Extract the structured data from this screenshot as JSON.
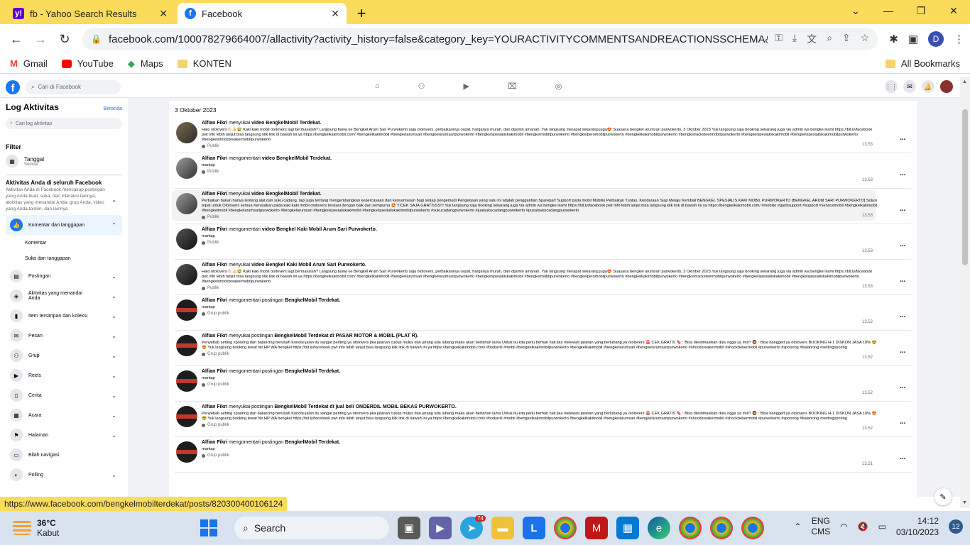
{
  "browser": {
    "tabs": [
      {
        "title": "fb - Yahoo Search Results",
        "icon": "yahoo-icon"
      },
      {
        "title": "Facebook",
        "icon": "facebook-icon"
      }
    ],
    "url": "facebook.com/100078279664007/allactivity?activity_history=false&category_key=YOURACTIVITYCOMMENTSANDREACTIONSSCHEMA&mana...",
    "profile_initial": "D",
    "bookmarks": [
      {
        "label": "Gmail",
        "color": "#ea4335"
      },
      {
        "label": "YouTube",
        "color": "#ff0000"
      },
      {
        "label": "Maps",
        "color": "#34a853"
      },
      {
        "label": "KONTEN",
        "color": "#f6d36b"
      }
    ],
    "all_bookmarks": "All Bookmarks",
    "status_url": "https://www.facebook.com/bengkelmobilterdekat/posts/820300400106124"
  },
  "fb": {
    "search_placeholder": "Cari di Facebook"
  },
  "sidebar": {
    "title": "Log Aktivitas",
    "home_link": "Beranda",
    "search_placeholder": "Cari log aktivitas",
    "filter_label": "Filter",
    "date_label": "Tanggal",
    "date_value": "Semua",
    "activity_title": "Aktivitas Anda di seluruh Facebook",
    "activity_desc": "Aktivitas Anda di Facebook mencakup postingan yang Anda buat, suka, dan interaksi lainnya, aktivitas yang menandai Anda, grup Anda, video yang Anda tonton, dan lainnya",
    "active_item": "Komentar dan tanggapan",
    "sub_items": [
      "Komentar",
      "Suka dan tanggapan"
    ],
    "items": [
      "Postingan",
      "Aktivitas yang menandai Anda",
      "Item tersimpan dan koleksi",
      "Pesan",
      "Grup",
      "Reels",
      "Cerita",
      "Acara",
      "Halaman",
      "Bilah navigasi",
      "Polling"
    ]
  },
  "log": {
    "date_header": "3 Oktober 2023",
    "entries": [
      {
        "actor": "Alfian Fikri",
        "verb": "menyukai",
        "object": "video BengkelMobil Terdekat.",
        "desc": "Halo otolovers👋🏻👍🏻😅 Kaki kaki mobil otolovers lagi bermasalah? Langsung bawa ke Bengkel Arum Sari Purwokerto saja otolovers, perbaikannya cepat, harganya murah, dan dijamin amanah. Yuk langsung merapat sekarang juga😍 Suasana bengkel arumsari purwokerto, 3 Oktober 2023 Yuk langsung saja booking sekarang juga via admin wa bengkel kami https://bit.ly/facebook pwt info lebih lanjut bisa langsung klik link di bawah ini ya https://bengkelkakimobil.com/ #bengkelkakimobil #bengkelarumsari #bengkelarumsaripurwokerto #bengkelspesialiskakimobil #bengkelmobilpurwokerto #bengkelperomobilpurwokerto #bengkelkakimobilpurwokerto #bengkelracksteermobilpurwokerto #bengkelspesialiskakimobil #bengkelspesialiskakimobilpurwokerto #bengkelshockbreakermobilpurwokerto",
        "audience": "Publik",
        "time": "13.53",
        "avatar": "gold"
      },
      {
        "actor": "Alfian Fikri",
        "verb": "mengomentari",
        "object": "video BengkelMobil Terdekat.",
        "desc": "mantap",
        "audience": "Publik",
        "time": "13.53",
        "avatar": "grey"
      },
      {
        "actor": "Alfian Fikri",
        "verb": "menyukai",
        "object": "video BengkelMobil Terdekat.",
        "desc": "Perbaikan bukan hanya tentang alat dan suku cadang, tapi juga tentang mengembangkan kepercayaan dan kenyamanan bagi setiap pengemudi Pengerjaan yang satu ini adalah penggantian Sparepart Support pada mobil Mobilio Perbaikan Tuntas, Kendaraan Siap Melaju Kembali BENGKEL SPESIALIS KAKI MOBIL PURWOKERTO [BENGKEL ARUM SARI PURWOKERTO] Solusi tepat untuk Otolovers semua Kerusakan pada kaki kaki mobil otolovers teratasi dengan baik dan sempurna 🤩 !!!CEK SAJA GRATISSS!!! Yuk langsung saja booking sekarang juga via admin wa bengkel kami https://bit.ly/facebook pwt Info lebih lanjut bisa langsung klik link di bawah ini ya https://bengkelkakimobil.com/ #mobilio #gantisupport #support #servicemobil #bengkelkakimobil #bengkelmobil #bengkelarumsaripurwokerto #bengkelarumsari #bengkelspesialiskakimobil #bengkelspesialiskakimobilpurwokerto #sukucadangpurwokerto #jualsukucadangpurwokerto #pusatsukucadangpurwokerto",
        "audience": "Publik",
        "time": "13.53",
        "avatar": "grey",
        "highlight": true
      },
      {
        "actor": "Alfian Fikri",
        "verb": "mengomentari",
        "object": "video Bengkel Kaki Mobil Arum Sari Purwokerto.",
        "desc": "mantap",
        "audience": "Publik",
        "time": "13.53",
        "avatar": "dark"
      },
      {
        "actor": "Alfian Fikri",
        "verb": "menyukai",
        "object": "video Bengkel Kaki Mobil Arum Sari Purwokerto.",
        "desc": "Halo otolovers👋🏻👍🏻😅 Kaki kaki mobil otolovers lagi bermasalah? Langsung bawa ke Bengkel Arum Sari Purwokerto saja otolovers, perbaikannya cepat, harganya murah, dan dijamin amanah. Yuk langsung merapat sekarang juga😍 Suasana bengkel arumsari purwokerto, 3 Oktober 2023 Yuk langsung saja booking sekarang juga via admin wa bengkel kami https://bit.ly/facebook pwt info lebih lanjut bisa langsung klik link di bawah ini ya https://bengkelkakimobil.com/ #bengkelkakimobil #bengkelarumsari #bengkelarumsaripurwokerto #bengkelspesialiskakimobil #bengkelmobilpurwokerto #bengkelperomobilpurwokerto #bengkelkakimobilpurwokerto #bengkelrracksteermobilpurwokerto #bengkelspesialiskakimobil #bengkelspesialiskakimobilpurwokerto #bengkelshockbreakermobilpurwokerto",
        "audience": "Publik",
        "time": "13.53",
        "avatar": "dark"
      },
      {
        "actor": "Alfian Fikri",
        "verb": "mengomentari postingan",
        "object": "BengkelMobil Terdekat.",
        "desc": "mantap",
        "audience": "Grup publik",
        "time": "13.52",
        "avatar": "red"
      },
      {
        "actor": "Alfian Fikri",
        "verb": "menyukai postingan",
        "object": "BengkelMobil Terdekat di PASAR MOTOR & MOBIL (PLAT R).",
        "desc": "Penyebab setting spooring dan balancing berubah Kondisi jalan itu sangat penting ya otolovers jika jalanan cukup mulus dan jarang ada lubang maka akan bertahan lama Untuk itu kita perlu berhati hati jika melewati jalanan yang berlubang ya otolovers 🚨 CEK GRATIS 🔖 : Bisa diestimasikan dulu ngga ya min? 🧔 : Bisa banggett ya otolovers BOOKING H-1 DISKON JASA 10% 😍😍 Yuk langsung booking lewat No HP WA bengkel https://bit.ly/facebook pwt info lebih lanjut bisa langsung klik link di bawah ini ya https://bengkelkakimobil.com/ #bodyroll #mobil #bengkelkakimobilpurwokerto #bengkelkakimobil #bengkelarumsari #bengkelarumsaripurwokerto #shockbreakermobil #shockbekermobil #purwokerto #spooring #balancing #settingsporing",
        "audience": "Grup publik",
        "time": "13.52",
        "avatar": "red"
      },
      {
        "actor": "Alfian Fikri",
        "verb": "mengomentari postingan",
        "object": "BengkelMobil Terdekat.",
        "desc": "mantap",
        "audience": "Grup publik",
        "time": "13.52",
        "avatar": "red"
      },
      {
        "actor": "Alfian Fikri",
        "verb": "menyukai postingan",
        "object": "BengkelMobil Terdekat di jual beli ONDERDIL MOBIL BEKAS PURWOKERTO.",
        "desc": "Penyebab setting spooring dan balancing berubah Kondisi jalan itu sangat penting ya otolovers jika jalanan cukup mulus dan jarang ada lubang maka akan bertahan lama Untuk itu kita perlu berhati hati jika melewati jalanan yang berlubang ya otolovers 🚨 CEK GRATIS 🔖 : Bisa diestimasikan dulu ngga ya min? 🧔 : Bisa banggett ya otolovers BOOKING H-1 DISKON JASA 10% 😍😍 Yuk langsung booking lewat No HP WA bengkel https://bit.ly/facebook pwt info lebih lanjut bisa langsung klik link di bawah ini ya https://bengkelkakimobil.com/ #bodyroll #mobil #bengkelkakimobilpurwokerto #bengkelkakimobil #bengkelarumsari #bengkelarumsaripurwokerto #shockbreakermobil #shockbekermobil #purwokerto #spooring #balancing #settingsporing",
        "audience": "Grup publik",
        "time": "13.52",
        "avatar": "red"
      },
      {
        "actor": "Alfian Fikri",
        "verb": "mengomentari postingan",
        "object": "BengkelMobil Terdekat.",
        "desc": "mantap",
        "audience": "Grup publik",
        "time": "13.51",
        "avatar": "red"
      }
    ]
  },
  "taskbar": {
    "temperature": "36°C",
    "condition": "Kabut",
    "search_label": "Search",
    "telegram_badge": "74",
    "lang_top": "ENG",
    "lang_bottom": "CMS",
    "time": "14:12",
    "date": "03/10/2023",
    "notifications": "12"
  }
}
